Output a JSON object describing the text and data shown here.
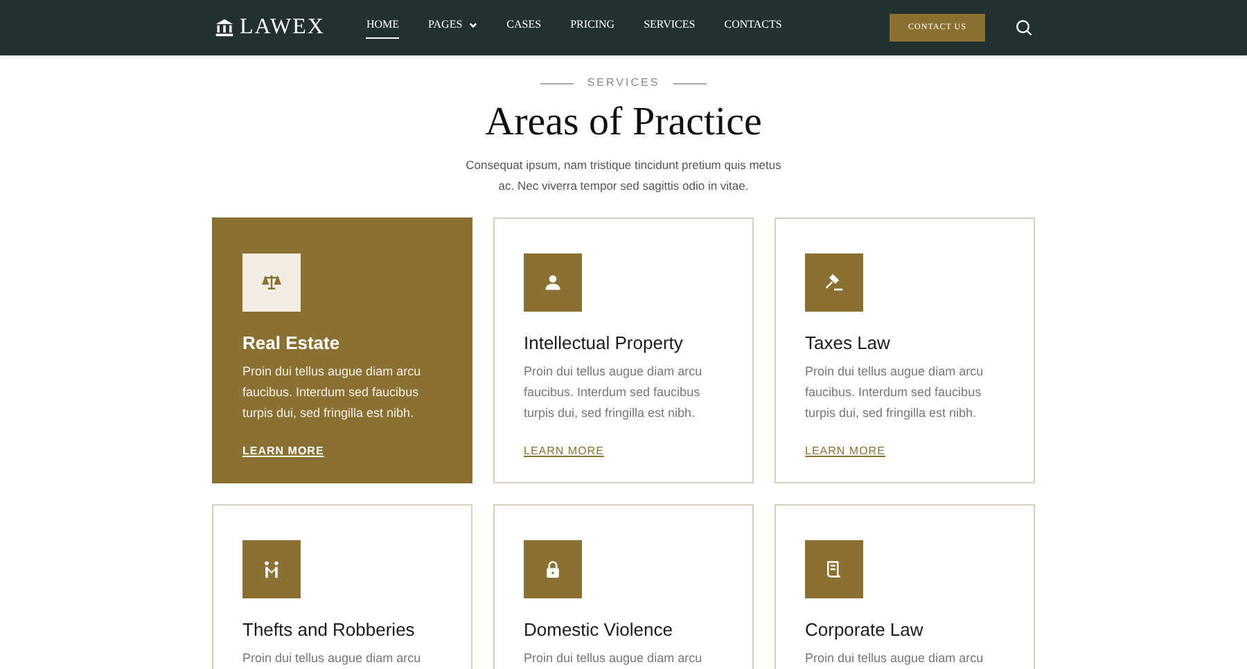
{
  "nav": {
    "logo": "LAWEX",
    "items": [
      {
        "label": "HOME",
        "selected": true,
        "dropdown": false
      },
      {
        "label": "PAGES",
        "selected": false,
        "dropdown": true
      },
      {
        "label": "CASES",
        "selected": false,
        "dropdown": false
      },
      {
        "label": "PRICING",
        "selected": false,
        "dropdown": false
      },
      {
        "label": "SERVICES",
        "selected": false,
        "dropdown": false
      },
      {
        "label": "CONTACTS",
        "selected": false,
        "dropdown": false
      }
    ],
    "cta": "CONTACT US"
  },
  "header": {
    "eyebrow": "SERVICES",
    "title": "Areas of Practice",
    "subtitle": "Consequat ipsum, nam tristique tincidunt pretium quis metus ac. Nec viverra tempor sed sagittis odio in vitae."
  },
  "cards": [
    {
      "kind": "scales",
      "title": "Real Estate",
      "body": "Proin dui tellus augue diam arcu faucibus. Interdum sed faucibus turpis dui, sed fringilla est nibh.",
      "link": "LEARN MORE",
      "selected": true
    },
    {
      "kind": "person",
      "title": "Intellectual Property",
      "body": "Proin dui tellus augue diam arcu faucibus. Interdum sed faucibus turpis dui, sed fringilla est nibh.",
      "link": "LEARN MORE",
      "selected": false
    },
    {
      "kind": "gavel",
      "title": "Taxes Law",
      "body": "Proin dui tellus augue diam arcu faucibus. Interdum sed faucibus turpis dui, sed fringilla est nibh.",
      "link": "LEARN MORE",
      "selected": false
    },
    {
      "kind": "people",
      "title": "Thefts and Robberies",
      "body": "Proin dui tellus augue diam arcu",
      "selected": false
    },
    {
      "kind": "lock",
      "title": "Domestic Violence",
      "body": "Proin dui tellus augue diam arcu",
      "selected": false
    },
    {
      "kind": "scroll",
      "title": "Corporate Law",
      "body": "Proin dui tellus augue diam arcu",
      "selected": false
    }
  ]
}
